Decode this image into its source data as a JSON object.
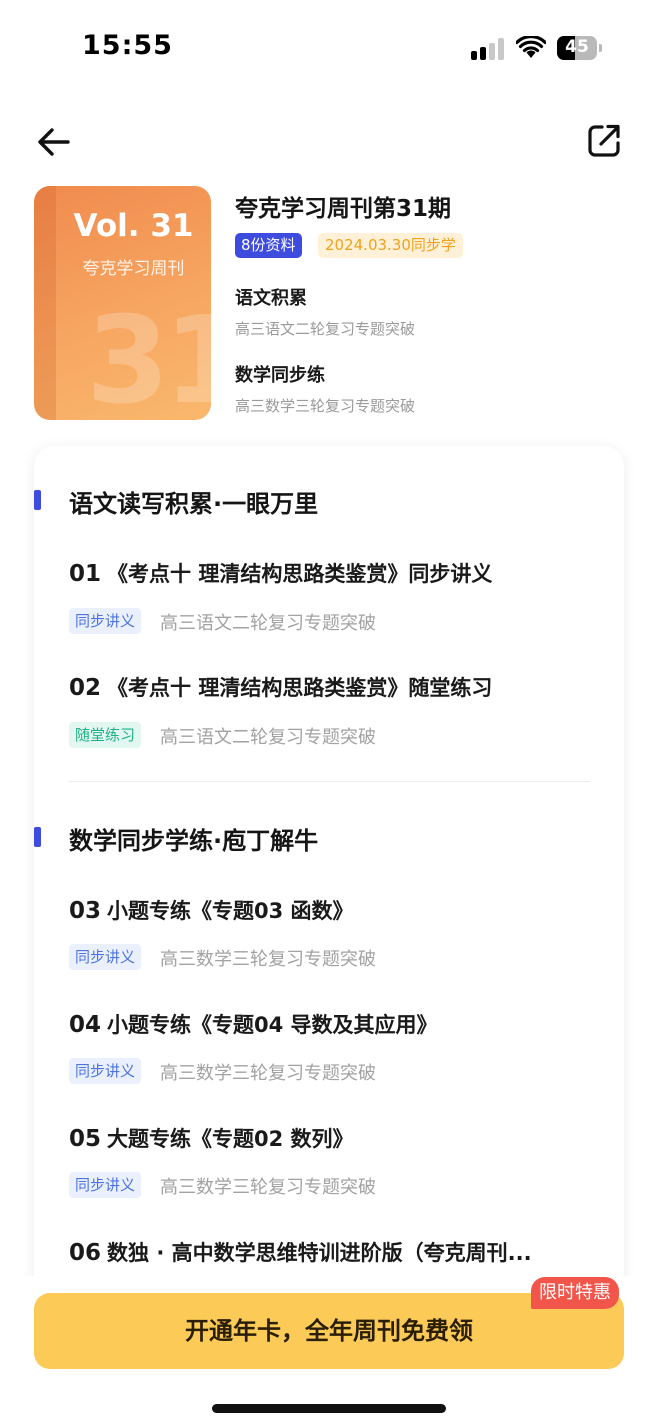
{
  "status_bar": {
    "time": "15:55",
    "battery": "45"
  },
  "nav": {
    "back_icon": "back-arrow-icon",
    "share_icon": "share-icon"
  },
  "cover": {
    "volume": "Vol. 31",
    "name": "夸克学习周刊",
    "big_number": "31"
  },
  "header": {
    "title": "夸克学习周刊第31期",
    "count_badge": "8份资料",
    "date_badge": "2024.03.30同步学",
    "summaries": [
      {
        "title": "语文积累",
        "subtitle": "高三语文二轮复习专题突破"
      },
      {
        "title": "数学同步练",
        "subtitle": "高三数学三轮复习专题突破"
      }
    ]
  },
  "sections": [
    {
      "title": "语文读写积累·一眼万里",
      "items": [
        {
          "num": "01",
          "title": "《考点十 理清结构思路类鉴赏》同步讲义",
          "tag": "同步讲义",
          "subtitle": "高三语文二轮复习专题突破"
        },
        {
          "num": "02",
          "title": "《考点十 理清结构思路类鉴赏》随堂练习",
          "tag": "随堂练习",
          "subtitle": "高三语文二轮复习专题突破"
        }
      ]
    },
    {
      "title": "数学同步学练·庖丁解牛",
      "items": [
        {
          "num": "03",
          "title": "小题专练《专题03 函数》",
          "tag": "同步讲义",
          "subtitle": "高三数学三轮复习专题突破"
        },
        {
          "num": "04",
          "title": "小题专练《专题04 导数及其应用》",
          "tag": "同步讲义",
          "subtitle": "高三数学三轮复习专题突破"
        },
        {
          "num": "05",
          "title": "大题专练《专题02 数列》",
          "tag": "同步讲义",
          "subtitle": "高三数学三轮复习专题突破"
        },
        {
          "num": "06",
          "title": "数独 · 高中数学思维特训进阶版（夸克周刊...",
          "tag": "",
          "subtitle": ""
        }
      ]
    }
  ],
  "cta": {
    "label": "开通年卡，全年周刊免费领",
    "promo": "限时特惠"
  },
  "colors": {
    "accent": "#3d4bde",
    "cta": "#fcca57",
    "promo": "#f2554a",
    "tag_green": "#1fb287",
    "tag_blue": "#4d74e0"
  }
}
